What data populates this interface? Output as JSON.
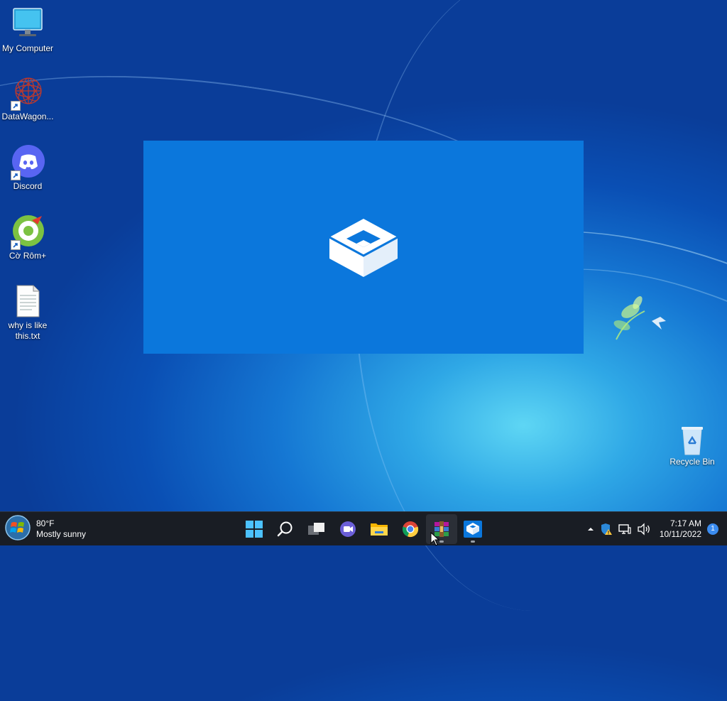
{
  "desktop": {
    "icons": [
      {
        "label": "My Computer",
        "icon": "computer-icon"
      },
      {
        "label": "DataWagon...",
        "icon": "datawagon-icon"
      },
      {
        "label": "Discord",
        "icon": "discord-icon"
      },
      {
        "label": "Cờ Rôm+",
        "icon": "coccoc-icon"
      },
      {
        "label": "why is like this.txt",
        "icon": "text-file-icon"
      },
      {
        "label": "Recycle Bin",
        "icon": "recycle-bin-icon"
      }
    ]
  },
  "splash": {
    "app": "Windows Sandbox",
    "icon": "sandbox-icon",
    "background": "#0b77dc"
  },
  "taskbar": {
    "weather": {
      "temp": "80°F",
      "condition": "Mostly sunny"
    },
    "apps": [
      {
        "name": "Start",
        "icon": "windows-logo-icon"
      },
      {
        "name": "Search",
        "icon": "search-icon"
      },
      {
        "name": "Task View",
        "icon": "task-view-icon"
      },
      {
        "name": "Chat",
        "icon": "chat-icon"
      },
      {
        "name": "File Explorer",
        "icon": "folder-icon"
      },
      {
        "name": "Google Chrome",
        "icon": "chrome-icon"
      },
      {
        "name": "WinRAR",
        "icon": "winrar-icon"
      },
      {
        "name": "Windows Sandbox",
        "icon": "sandbox-icon"
      }
    ],
    "tray": {
      "icons": [
        "chevron-up-icon",
        "defender-warning-icon",
        "network-icon",
        "volume-icon"
      ],
      "time": "7:17 AM",
      "date": "10/11/2022",
      "notification_count": "1"
    }
  },
  "colors": {
    "accent": "#0b77dc",
    "taskbar": "#191d24",
    "notification": "#3b8cf0"
  }
}
